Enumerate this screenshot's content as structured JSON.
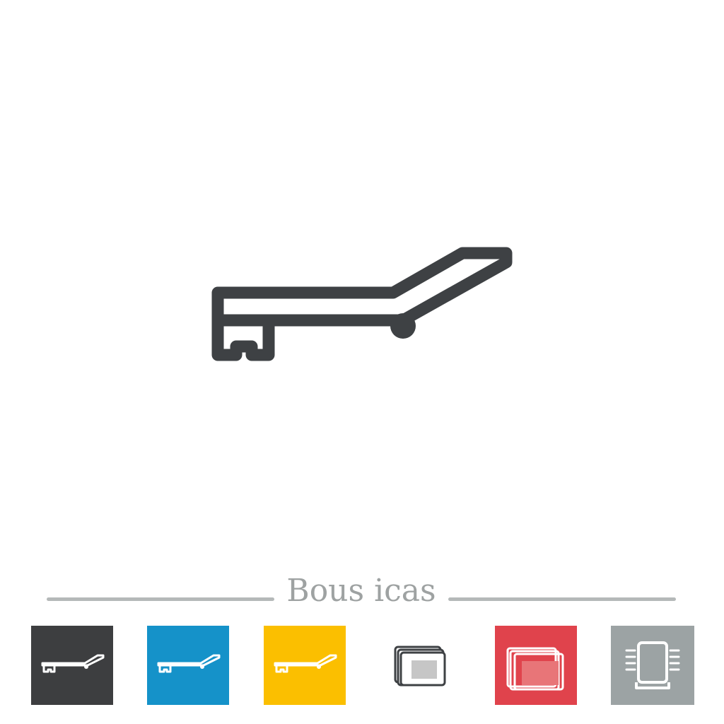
{
  "colors": {
    "icon_dark": "#3e4144",
    "tile_dark": "#3d3e40",
    "tile_blue": "#1592c9",
    "tile_yellow": "#fbbf00",
    "tile_white": "#ffffff",
    "tile_red": "#e0434c",
    "tile_gray": "#9ca3a4",
    "divider": "#b5b9b9"
  },
  "main_icon": "sun-lounger-icon",
  "bonus_heading": "Bous icas",
  "tiles": [
    {
      "icon": "sun-lounger-icon",
      "background": "#3d3e40"
    },
    {
      "icon": "sun-lounger-icon",
      "background": "#1592c9"
    },
    {
      "icon": "sun-lounger-icon",
      "background": "#fbbf00"
    },
    {
      "icon": "stacked-screens-icon",
      "background": "#ffffff"
    },
    {
      "icon": "stacked-screens-icon",
      "background": "#e0434c"
    },
    {
      "icon": "tablet-stand-icon",
      "background": "#9ca3a4"
    }
  ]
}
